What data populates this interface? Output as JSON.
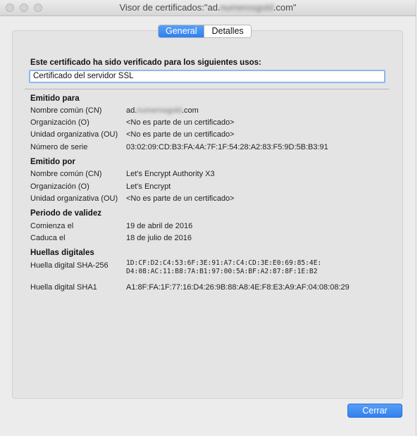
{
  "window": {
    "title_prefix": "Visor de certificados:\"ad.",
    "title_blurred": "numerosgold",
    "title_suffix": ".com\""
  },
  "tabs": [
    {
      "label": "General",
      "active": true
    },
    {
      "label": "Detalles",
      "active": false
    }
  ],
  "uses": {
    "label": "Este certificado ha sido verificado para los siguientes usos:",
    "value": "Certificado del servidor SSL"
  },
  "issued_to": {
    "heading": "Emitido para",
    "cn_label": "Nombre común (CN)",
    "cn_prefix": "ad.",
    "cn_blurred": "numerosgold",
    "cn_suffix": ".com",
    "o_label": "Organización (O)",
    "o_value": "<No es parte de un certificado>",
    "ou_label": "Unidad organizativa (OU)",
    "ou_value": "<No es parte de un certificado>",
    "serial_label": "Número de serie",
    "serial_value": "03:02:09:CD:B3:FA:4A:7F:1F:54:28:A2:83:F5:9D:5B:B3:91"
  },
  "issued_by": {
    "heading": "Emitido por",
    "cn_label": "Nombre común (CN)",
    "cn_value": "Let's Encrypt Authority X3",
    "o_label": "Organización (O)",
    "o_value": "Let's Encrypt",
    "ou_label": "Unidad organizativa (OU)",
    "ou_value": "<No es parte de un certificado>"
  },
  "validity": {
    "heading": "Periodo de validez",
    "start_label": "Comienza el",
    "start_value": "19 de abril de 2016",
    "end_label": "Caduca el",
    "end_value": "18 de julio de 2016"
  },
  "fingerprints": {
    "heading": "Huellas digitales",
    "sha256_label": "Huella digital SHA-256",
    "sha256_line1": "1D:CF:D2:C4:53:6F:3E:91:A7:C4:CD:3E:E0:69:85:4E:",
    "sha256_line2": "D4:08:AC:11:B8:7A:B1:97:00:5A:BF:A2:87:8F:1E:B2",
    "sha1_label": "Huella digital SHA1",
    "sha1_value": "A1:8F:FA:1F:77:16:D4:26:9B:88:A8:4E:F8:E3:A9:AF:04:08:08:29"
  },
  "buttons": {
    "close": "Cerrar"
  }
}
